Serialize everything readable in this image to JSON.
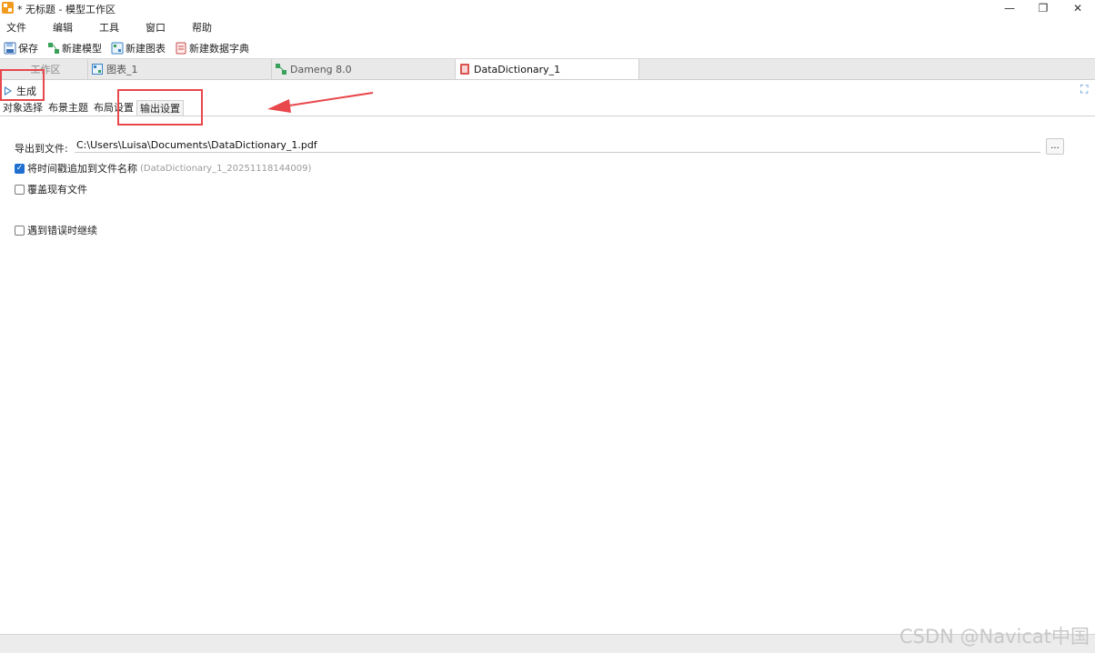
{
  "window": {
    "title": "* 无标题 - 模型工作区",
    "controls": {
      "minimize": "—",
      "restore": "❐",
      "close": "✕"
    }
  },
  "menu": {
    "items": [
      "文件",
      "编辑",
      "工具",
      "窗口",
      "帮助"
    ]
  },
  "toolbar": {
    "save_label": "保存",
    "new_model_label": "新建模型",
    "new_diagram_label": "新建图表",
    "new_datadict_label": "新建数据字典"
  },
  "tabs": [
    {
      "label": "工作区",
      "icon": "none"
    },
    {
      "label": "图表_1",
      "icon": "diagram-icon"
    },
    {
      "label": "Dameng 8.0",
      "icon": "model-icon"
    },
    {
      "label": "DataDictionary_1",
      "icon": "datadict-icon",
      "active": true
    }
  ],
  "action": {
    "generate_label": "生成"
  },
  "subtabs": [
    {
      "label": "对象选择"
    },
    {
      "label": "布景主题"
    },
    {
      "label": "布局设置"
    },
    {
      "label": "输出设置",
      "active": true
    }
  ],
  "output": {
    "export_label": "导出到文件:",
    "export_path": "C:\\Users\\Luisa\\Documents\\DataDictionary_1.pdf",
    "browse_label": "...",
    "timestamp_label": "将时间戳追加到文件名称",
    "timestamp_checked": true,
    "timestamp_preview": "(DataDictionary_1_20251118144009)",
    "overwrite_label": "覆盖现有文件",
    "overwrite_checked": false,
    "continue_label": "遇到错误时继续",
    "continue_checked": false
  },
  "watermark": "CSDN @Navicat中国",
  "colors": {
    "accent": "#1f6fd1",
    "annotation_red": "#e8474b",
    "tab_strip": "#e9e9e9"
  }
}
